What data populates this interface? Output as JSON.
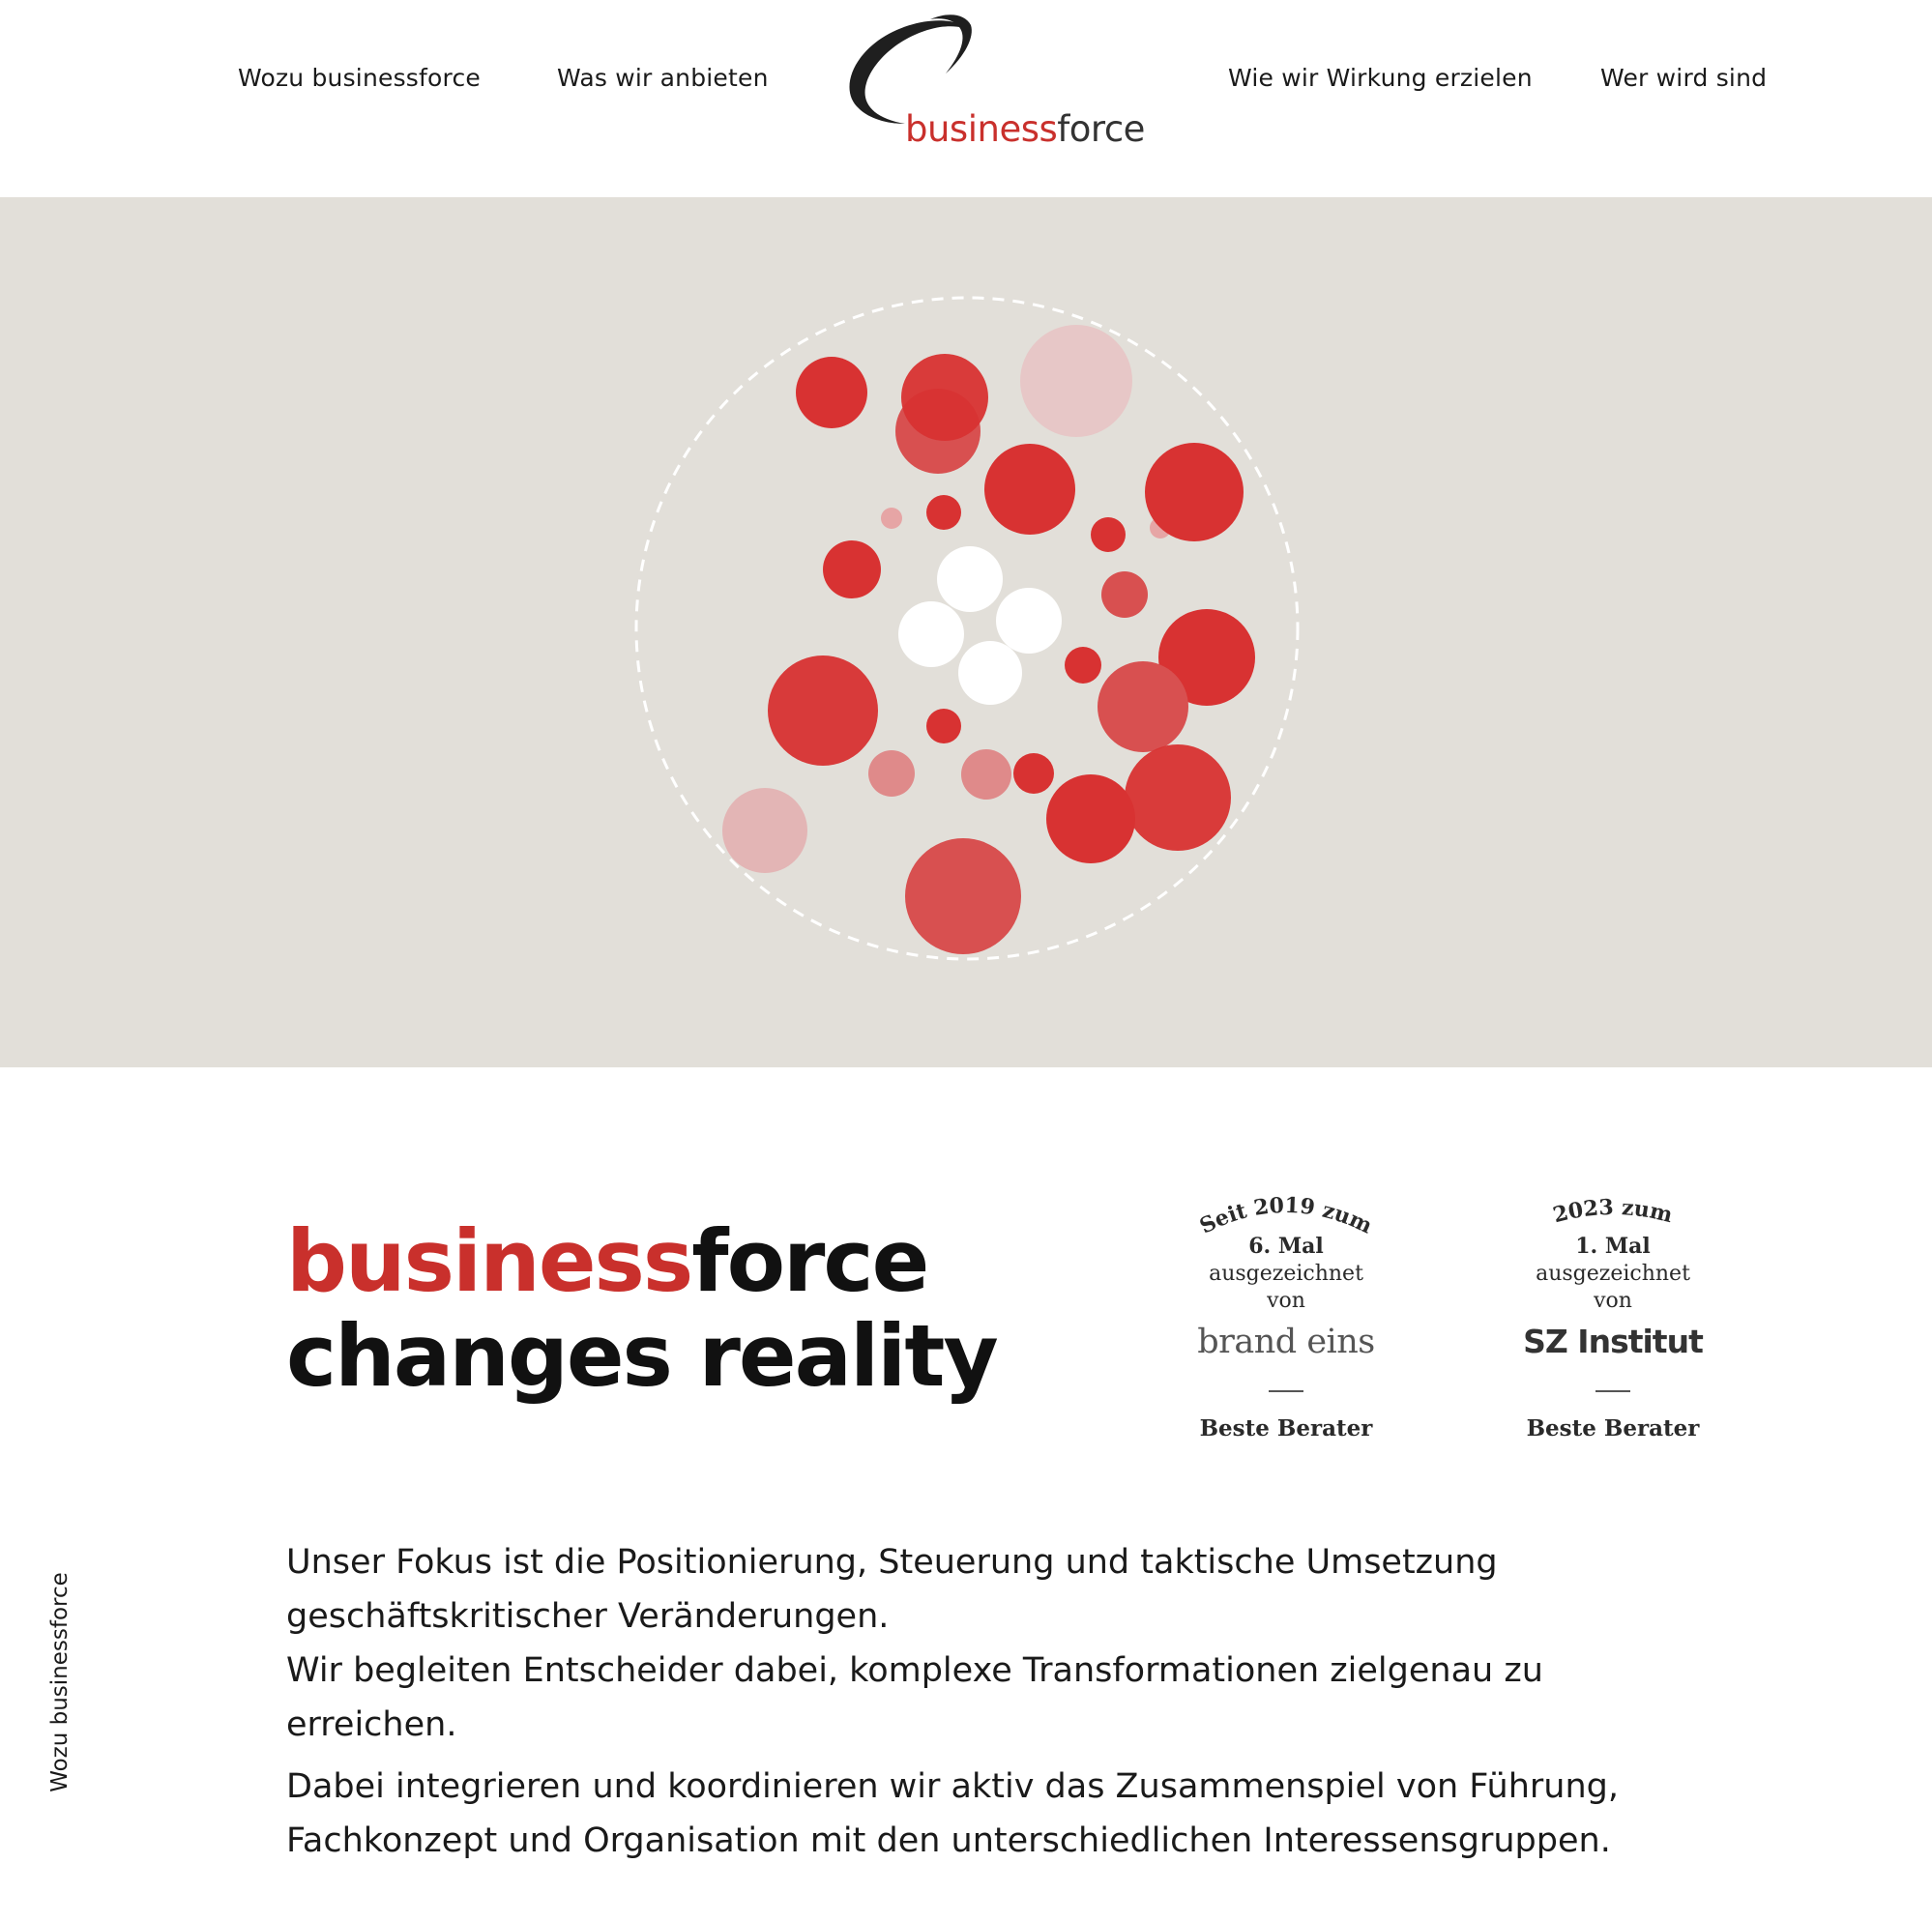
{
  "nav": {
    "left": [
      "Wozu businessforce",
      "Was wir anbieten"
    ],
    "right": [
      "Wie wir Wirkung erzielen",
      "Wer wird sind"
    ]
  },
  "logo": {
    "part1": "business",
    "part2": "force"
  },
  "headline": {
    "brand_red": "business",
    "brand_dark": "force",
    "line2": "changes reality"
  },
  "awards": [
    {
      "since": "Seit 2019 zum",
      "count": "6. Mal",
      "line1": "ausgezeichnet",
      "line2": "von",
      "brand": "brand eins",
      "category": "Beste Berater"
    },
    {
      "since": "2023 zum",
      "count": "1. Mal",
      "line1": "ausgezeichnet",
      "line2": "von",
      "brand": "SZ Institut",
      "category": "Beste Berater"
    }
  ],
  "intro": {
    "p1": "Unser Fokus ist die Positionierung, Steuerung und taktische Umsetzung geschäftskritischer Veränderungen.",
    "p2": "Wir begleiten Entscheider dabei, komplexe Transformationen zielgenau zu erreichen.",
    "p3": "Dabei integrieren und koordinieren wir aktiv das Zusammenspiel von Führung, Fachkonzept und Organisation mit den unterschiedlichen Interessensgruppen."
  },
  "side_label": "Wozu businessforce",
  "colors": {
    "brand_red": "#c9302c",
    "hero_bg": "#e2dfd9",
    "dot_red": "#d83232"
  }
}
